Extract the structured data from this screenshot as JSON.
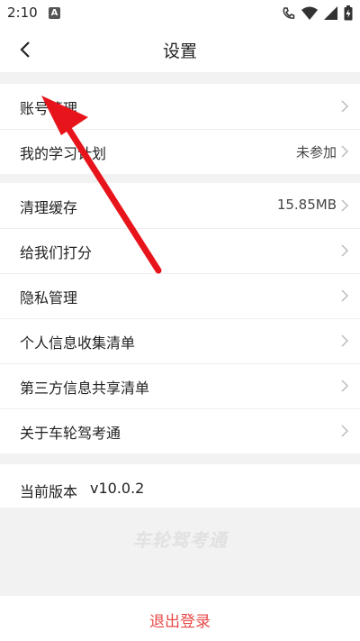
{
  "status_bar": {
    "time": "2:10",
    "notification_letter": "A",
    "icons": [
      "call-icon",
      "wifi-icon",
      "signal-icon",
      "battery-icon"
    ]
  },
  "header": {
    "title": "设置",
    "back_icon": "back-arrow-icon"
  },
  "group1": {
    "items": [
      {
        "label": "账号管理",
        "value": ""
      },
      {
        "label": "我的学习计划",
        "value": "未参加"
      }
    ]
  },
  "group2": {
    "items": [
      {
        "label": "清理缓存",
        "value": "15.85MB"
      },
      {
        "label": "给我们打分",
        "value": ""
      },
      {
        "label": "隐私管理",
        "value": ""
      },
      {
        "label": "个人信息收集清单",
        "value": ""
      },
      {
        "label": "第三方信息共享清单",
        "value": ""
      },
      {
        "label": "关于车轮驾考通",
        "value": ""
      }
    ]
  },
  "version": {
    "label": "当前版本",
    "value": "v10.0.2"
  },
  "watermark_logo": "车轮驾考通",
  "logout": {
    "label": "退出登录"
  },
  "colors": {
    "accent_red": "#e84a4a",
    "annotation_arrow": "#e8141b",
    "background": "#f2f2f2"
  }
}
